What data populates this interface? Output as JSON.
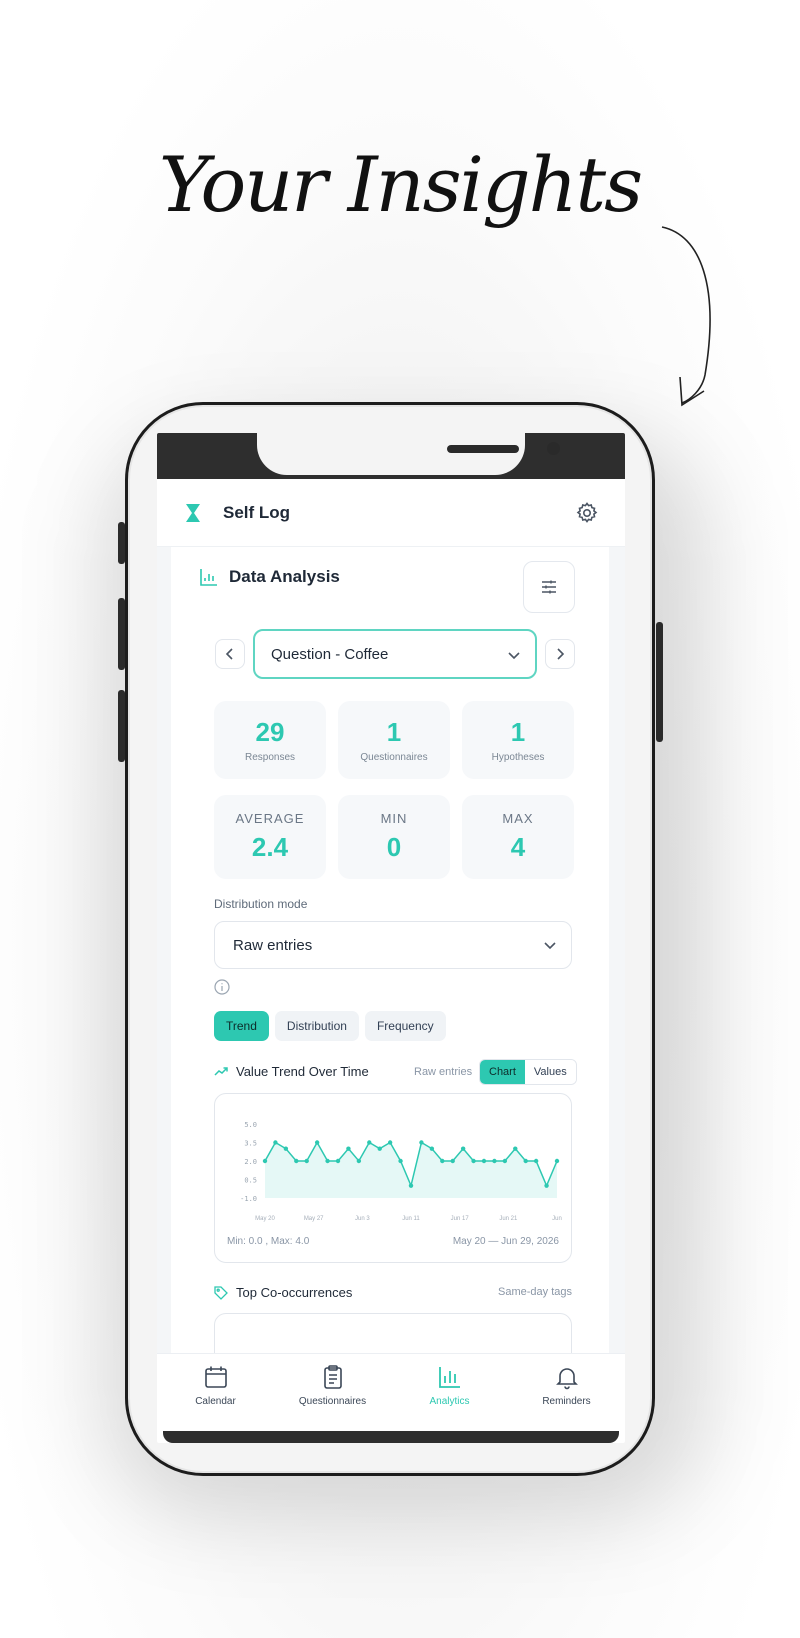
{
  "headline": "Your Insights",
  "app": {
    "title": "Self Log"
  },
  "analysis": {
    "title": "Data Analysis",
    "selected_question": "Question - Coffee"
  },
  "stats_top": [
    {
      "value": "29",
      "label": "Responses"
    },
    {
      "value": "1",
      "label": "Questionnaires"
    },
    {
      "value": "1",
      "label": "Hypotheses"
    }
  ],
  "stats_summary": [
    {
      "label": "AVERAGE",
      "value": "2.4"
    },
    {
      "label": "MIN",
      "value": "0"
    },
    {
      "label": "MAX",
      "value": "4"
    }
  ],
  "distribution": {
    "label": "Distribution mode",
    "selected": "Raw entries"
  },
  "tabs": [
    "Trend",
    "Distribution",
    "Frequency"
  ],
  "active_tab": "Trend",
  "trend": {
    "title": "Value Trend Over Time",
    "mode_label": "Raw entries",
    "toggle": [
      "Chart",
      "Values"
    ],
    "footer_left": "Min: 0.0 , Max: 4.0",
    "footer_right": "May 20 — Jun 29, 2026"
  },
  "chart_data": {
    "type": "area",
    "title": "Value Trend Over Time",
    "y_ticks": [
      "5.0",
      "3.5",
      "2.0",
      "0.5",
      "-1.0"
    ],
    "x_ticks": [
      "May 20",
      "May 27",
      "Jun 3",
      "Jun 11",
      "Jun 17",
      "Jun 21",
      "Jun"
    ],
    "ylim": [
      -1.0,
      5.0
    ],
    "values": [
      2,
      3.5,
      3,
      2,
      2,
      3.5,
      2,
      2,
      3,
      2,
      3.5,
      3,
      3.5,
      2,
      0,
      3.5,
      3,
      2,
      2,
      3,
      2,
      2,
      2,
      2,
      3,
      2,
      2,
      0,
      2
    ],
    "color": "#2dc8b1"
  },
  "cooccurrence": {
    "title": "Top Co-occurrences",
    "right_label": "Same-day tags"
  },
  "bottom_nav": [
    {
      "label": "Calendar",
      "icon": "calendar-icon"
    },
    {
      "label": "Questionnaires",
      "icon": "clipboard-icon"
    },
    {
      "label": "Analytics",
      "icon": "bar-chart-icon"
    },
    {
      "label": "Reminders",
      "icon": "bell-icon"
    }
  ],
  "active_nav": "Analytics",
  "colors": {
    "accent": "#2dc8b1",
    "text": "#1f2937",
    "muted": "#8a96a6"
  }
}
